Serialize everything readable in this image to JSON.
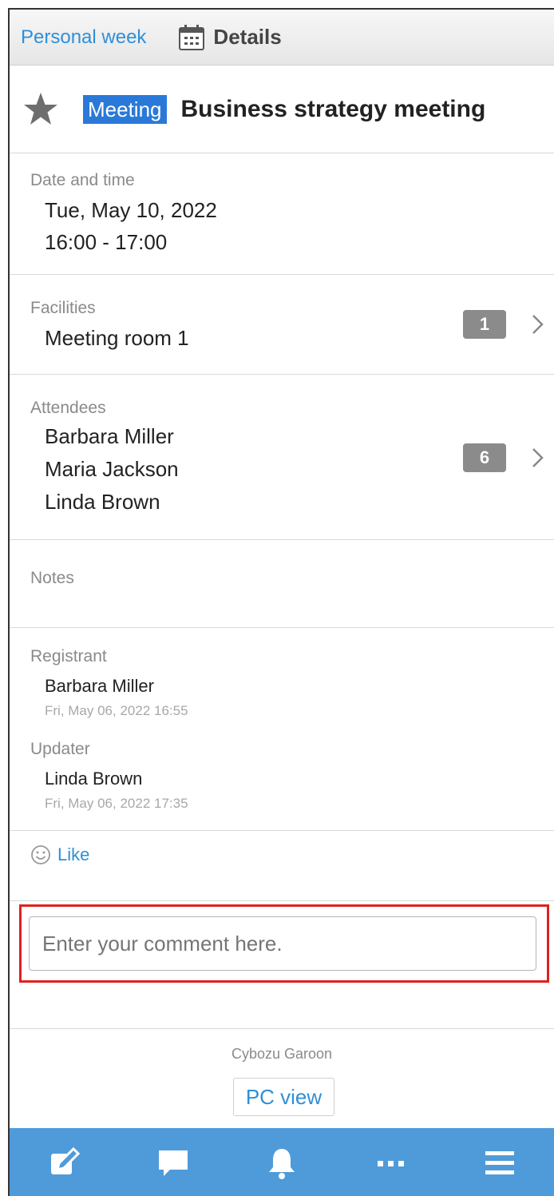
{
  "header": {
    "back_label": "Personal week",
    "title": "Details",
    "calendar_icon": "calendar-icon"
  },
  "event": {
    "star_icon": "star-icon",
    "menu": "Meeting",
    "title": "Business strategy meeting"
  },
  "date_time": {
    "label": "Date and time",
    "date": "Tue, May 10, 2022",
    "time": "16:00  -  17:00"
  },
  "facilities": {
    "label": "Facilities",
    "items": [
      "Meeting room 1"
    ],
    "count": "1"
  },
  "attendees": {
    "label": "Attendees",
    "items": [
      "Barbara Miller",
      "Maria Jackson",
      "Linda Brown"
    ],
    "count": "6"
  },
  "notes": {
    "label": "Notes"
  },
  "registrant": {
    "label": "Registrant",
    "name": "Barbara Miller",
    "timestamp": "Fri, May 06, 2022 16:55"
  },
  "updater": {
    "label": "Updater",
    "name": "Linda Brown",
    "timestamp": "Fri, May 06, 2022 17:35"
  },
  "like": {
    "label": "Like",
    "icon": "smile-icon"
  },
  "comment": {
    "placeholder": "Enter your comment here."
  },
  "footer": {
    "brand": "Cybozu Garoon",
    "pc_view": "PC view"
  },
  "bottom_nav": {
    "items": [
      "compose-icon",
      "comment-icon",
      "notification-bell-icon",
      "more-icon",
      "menu-icon"
    ],
    "background": "#4f9bd9"
  },
  "colors": {
    "link": "#2f8fd8",
    "badge_blue": "#2a79d8",
    "highlight": "#e02020"
  }
}
